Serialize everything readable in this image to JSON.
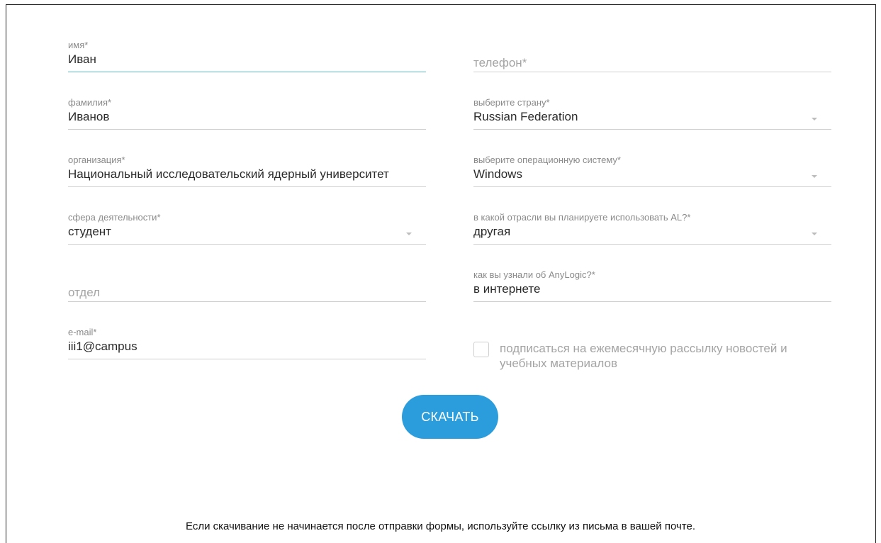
{
  "form": {
    "left_fields": [
      {
        "label": "имя*",
        "value": "Иван"
      },
      {
        "label": "фамилия*",
        "value": "Иванов"
      },
      {
        "label": "организация*",
        "value": "Национальный исследовательский ядерный университет"
      },
      {
        "label": "сфера деятельности*",
        "value": "студент"
      },
      {
        "placeholder": "отдел"
      },
      {
        "label": "e-mail*",
        "value": "iii1@campus"
      }
    ],
    "right_fields": [
      {
        "placeholder": "телефон*"
      },
      {
        "label": "выберите страну*",
        "value": "Russian Federation"
      },
      {
        "label": "выберите операционную систему*",
        "value": "Windows"
      },
      {
        "label": "в какой отрасли вы планируете использовать AL?*",
        "value": "другая"
      },
      {
        "label": "как вы узнали об AnyLogic?*",
        "value": "в интернете"
      }
    ],
    "subscribe_label": "подписаться на ежемесячную рассылку новостей и учебных материалов",
    "subscribe_checked": false,
    "submit_label": "СКАЧАТЬ"
  },
  "footer": {
    "note": "Если скачивание не начинается после отправки формы, используйте ссылку из письма в вашей почте."
  },
  "colors": {
    "accent": "#2b9ddc",
    "active_underline": "#5cb8c9"
  }
}
